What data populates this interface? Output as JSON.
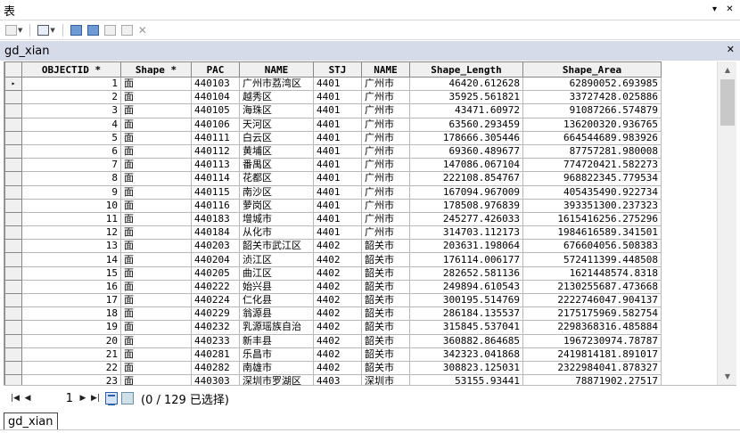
{
  "window": {
    "title": "表"
  },
  "table_tab": {
    "name": "gd_xian"
  },
  "columns": [
    "OBJECTID *",
    "Shape *",
    "PAC",
    "NAME",
    "STJ",
    "NAME",
    "Shape_Length",
    "Shape_Area"
  ],
  "rows": [
    [
      "1",
      "面",
      "440103",
      "广州市荔湾区",
      "4401",
      "广州市",
      "46420.612628",
      "62890052.693985"
    ],
    [
      "2",
      "面",
      "440104",
      "越秀区",
      "4401",
      "广州市",
      "35925.561821",
      "33727428.025886"
    ],
    [
      "3",
      "面",
      "440105",
      "海珠区",
      "4401",
      "广州市",
      "43471.60972",
      "91087266.574879"
    ],
    [
      "4",
      "面",
      "440106",
      "天河区",
      "4401",
      "广州市",
      "63560.293459",
      "136200320.936765"
    ],
    [
      "5",
      "面",
      "440111",
      "白云区",
      "4401",
      "广州市",
      "178666.305446",
      "664544689.983926"
    ],
    [
      "6",
      "面",
      "440112",
      "黄埔区",
      "4401",
      "广州市",
      "69360.489677",
      "87757281.980008"
    ],
    [
      "7",
      "面",
      "440113",
      "番禺区",
      "4401",
      "广州市",
      "147086.067104",
      "774720421.582273"
    ],
    [
      "8",
      "面",
      "440114",
      "花都区",
      "4401",
      "广州市",
      "222108.854767",
      "968822345.779534"
    ],
    [
      "9",
      "面",
      "440115",
      "南沙区",
      "4401",
      "广州市",
      "167094.967009",
      "405435490.922734"
    ],
    [
      "10",
      "面",
      "440116",
      "萝岗区",
      "4401",
      "广州市",
      "178508.976839",
      "393351300.237323"
    ],
    [
      "11",
      "面",
      "440183",
      "增城市",
      "4401",
      "广州市",
      "245277.426033",
      "1615416256.275296"
    ],
    [
      "12",
      "面",
      "440184",
      "从化市",
      "4401",
      "广州市",
      "314703.112173",
      "1984616589.341501"
    ],
    [
      "13",
      "面",
      "440203",
      "韶关市武江区",
      "4402",
      "韶关市",
      "203631.198064",
      "676604056.508383"
    ],
    [
      "14",
      "面",
      "440204",
      "浈江区",
      "4402",
      "韶关市",
      "176114.006177",
      "572411399.448508"
    ],
    [
      "15",
      "面",
      "440205",
      "曲江区",
      "4402",
      "韶关市",
      "282652.581136",
      "1621448574.8318"
    ],
    [
      "16",
      "面",
      "440222",
      "始兴县",
      "4402",
      "韶关市",
      "249894.610543",
      "2130255687.473668"
    ],
    [
      "17",
      "面",
      "440224",
      "仁化县",
      "4402",
      "韶关市",
      "300195.514769",
      "2222746047.904137"
    ],
    [
      "18",
      "面",
      "440229",
      "翁源县",
      "4402",
      "韶关市",
      "286184.135537",
      "2175175969.582754"
    ],
    [
      "19",
      "面",
      "440232",
      "乳源瑶族自治",
      "4402",
      "韶关市",
      "315845.537041",
      "2298368316.485884"
    ],
    [
      "20",
      "面",
      "440233",
      "新丰县",
      "4402",
      "韶关市",
      "360882.864685",
      "1967230974.78787"
    ],
    [
      "21",
      "面",
      "440281",
      "乐昌市",
      "4402",
      "韶关市",
      "342323.041868",
      "2419814181.891017"
    ],
    [
      "22",
      "面",
      "440282",
      "南雄市",
      "4402",
      "韶关市",
      "308823.125031",
      "2322984041.878327"
    ],
    [
      "23",
      "面",
      "440303",
      "深圳市罗湖区",
      "4403",
      "深圳市",
      "53155.93441",
      "78871902.27517"
    ]
  ],
  "current_row_marker": "▸",
  "navigation": {
    "current_record": "1",
    "status": "(0 / 129 已选择)"
  },
  "bottom_tab": {
    "name": "gd_xian"
  }
}
